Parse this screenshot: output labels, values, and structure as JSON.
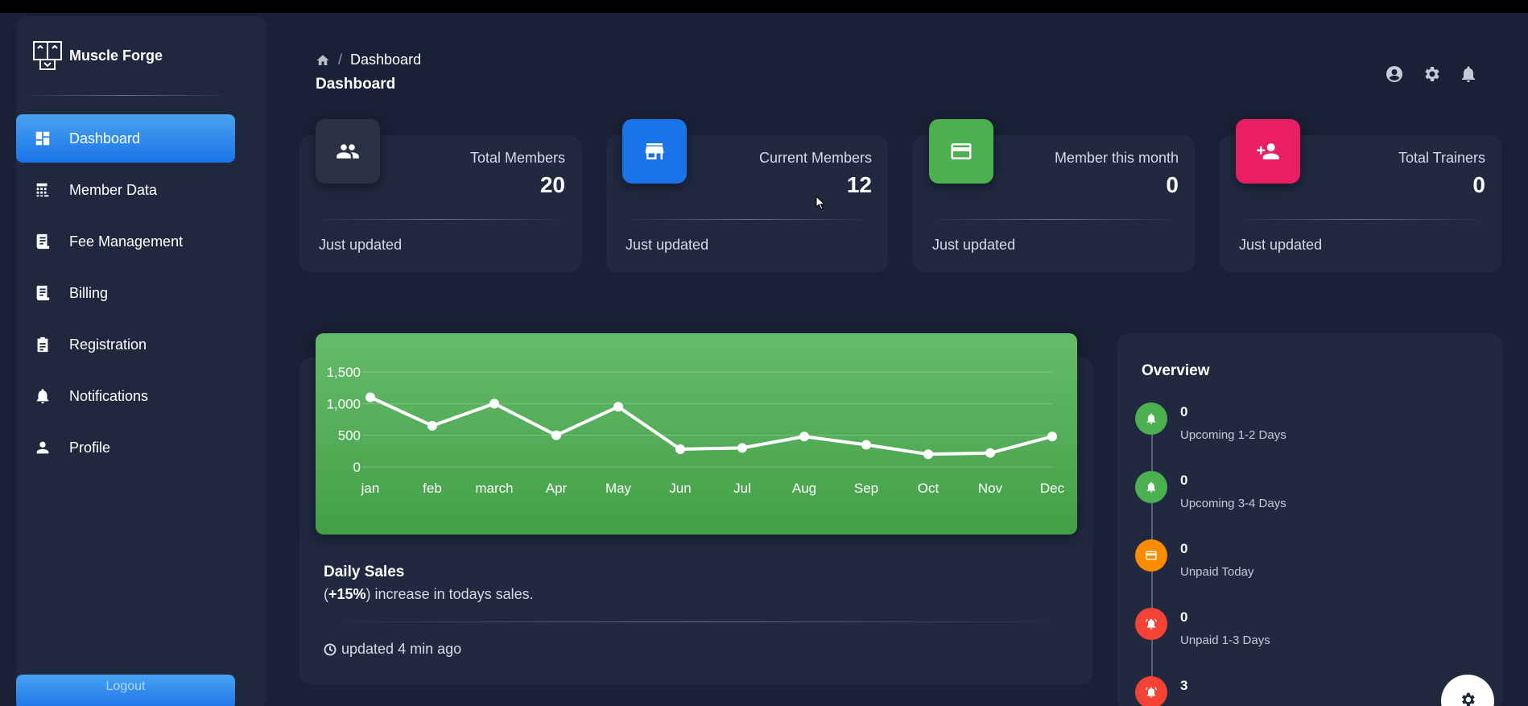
{
  "app": {
    "name": "Muscle Forge"
  },
  "sidebar": {
    "items": [
      {
        "label": "Dashboard",
        "icon": "dashboard-icon",
        "active": true
      },
      {
        "label": "Member Data",
        "icon": "calculator-icon"
      },
      {
        "label": "Fee Management",
        "icon": "receipt-icon"
      },
      {
        "label": "Billing",
        "icon": "receipt-icon"
      },
      {
        "label": "Registration",
        "icon": "clipboard-icon"
      },
      {
        "label": "Notifications",
        "icon": "bell-icon"
      },
      {
        "label": "Profile",
        "icon": "person-icon"
      }
    ],
    "logout_label": "Logout"
  },
  "header": {
    "breadcrumb_current": "Dashboard",
    "breadcrumb_separator": "/",
    "title": "Dashboard"
  },
  "stats": [
    {
      "label": "Total Members",
      "value": "20",
      "footer": "Just updated",
      "icon": "people-icon",
      "color": "#2c3144"
    },
    {
      "label": "Current Members",
      "value": "12",
      "footer": "Just updated",
      "icon": "store-icon",
      "color": "#1a73e8"
    },
    {
      "label": "Member this month",
      "value": "0",
      "footer": "Just updated",
      "icon": "credit-card-icon",
      "color": "#4caf50"
    },
    {
      "label": "Total Trainers",
      "value": "0",
      "footer": "Just updated",
      "icon": "person-add-icon",
      "color": "#e91e63"
    }
  ],
  "sales": {
    "title": "Daily Sales",
    "percent": "+15%",
    "subtitle_rest": "increase in todays sales.",
    "updated": "updated 4 min ago"
  },
  "chart_data": {
    "type": "line",
    "title": "",
    "xlabel": "",
    "ylabel": "",
    "categories": [
      "jan",
      "feb",
      "march",
      "Apr",
      "May",
      "Jun",
      "Jul",
      "Aug",
      "Sep",
      "Oct",
      "Nov",
      "Dec"
    ],
    "values": [
      1100,
      650,
      1000,
      500,
      950,
      280,
      300,
      480,
      350,
      200,
      220,
      480
    ],
    "yticks": [
      "0",
      "500",
      "1,000",
      "1,500"
    ],
    "ylim": [
      0,
      1500
    ],
    "grid": true,
    "line_color": "#ffffff",
    "background": "#4caf50"
  },
  "overview": {
    "title": "Overview",
    "items": [
      {
        "count": "0",
        "label": "Upcoming 1-2 Days",
        "icon": "bell-icon",
        "color": "#4caf50"
      },
      {
        "count": "0",
        "label": "Upcoming 3-4 Days",
        "icon": "bell-icon",
        "color": "#4caf50"
      },
      {
        "count": "0",
        "label": "Unpaid Today",
        "icon": "credit-card-icon",
        "color": "#fb8c00"
      },
      {
        "count": "0",
        "label": "Unpaid 1-3 Days",
        "icon": "alarm-icon",
        "color": "#f44335"
      },
      {
        "count": "3",
        "label": "",
        "icon": "alarm-icon",
        "color": "#f44335"
      }
    ]
  }
}
